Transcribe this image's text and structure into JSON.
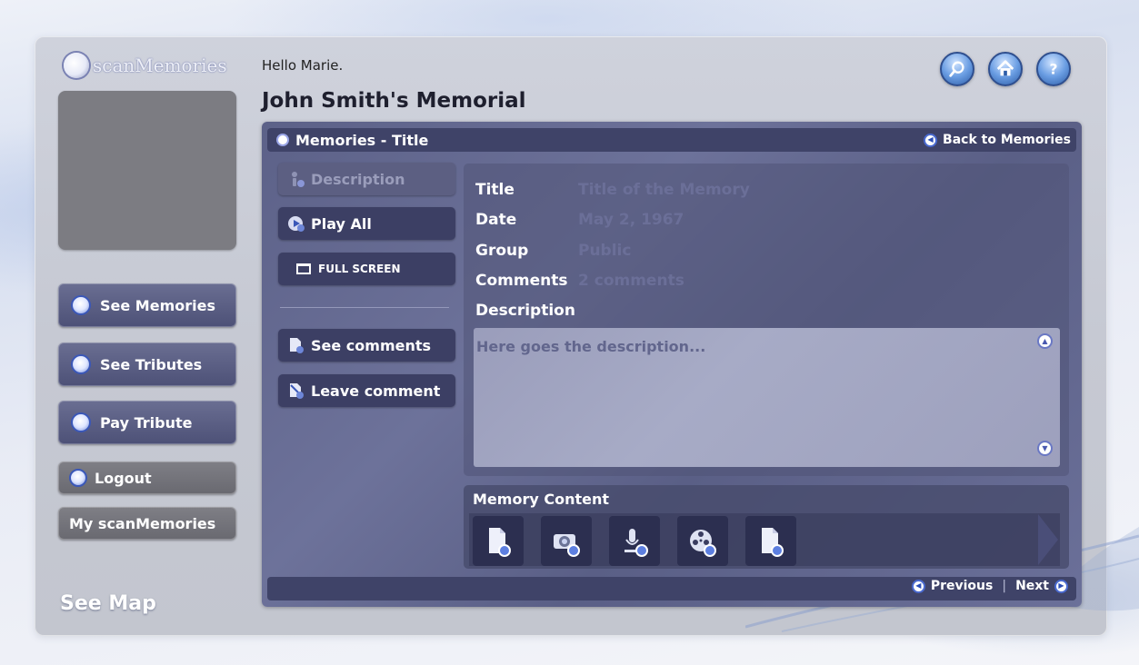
{
  "app": {
    "logo_text": "scanMemories"
  },
  "header": {
    "greeting": "Hello Marie.",
    "memorial_title": "John Smith's Memorial"
  },
  "top_icons": [
    "search-icon",
    "home-icon",
    "help-icon"
  ],
  "sidebar": {
    "see_memories": "See Memories",
    "see_tributes": "See Tributes",
    "pay_tribute": "Pay Tribute",
    "logout": "Logout",
    "my_scanmemories": "My scanMemories",
    "see_map": "See Map"
  },
  "panel": {
    "title": "Memories - Title",
    "back_link": "Back to Memories"
  },
  "actions": {
    "description": "Description",
    "play_all": "Play All",
    "full_screen": "FULL SCREEN",
    "see_comments": "See comments",
    "leave_comment": "Leave comment"
  },
  "details": {
    "title_label": "Title",
    "title_value": "Title of the Memory",
    "date_label": "Date",
    "date_value": "May 2, 1967",
    "group_label": "Group",
    "group_value": "Public",
    "comments_label": "Comments",
    "comments_value": "2 comments",
    "description_label": "Description",
    "description_text": "Here goes the description..."
  },
  "memory_content": {
    "title": "Memory Content",
    "items": [
      "document-icon",
      "camera-icon",
      "microphone-icon",
      "film-reel-icon",
      "document-icon"
    ]
  },
  "footer": {
    "previous": "Previous",
    "divider": "|",
    "next": "Next"
  },
  "colors": {
    "panel": "#5c6188",
    "header_bar": "#3f4368",
    "button": "#3c3f64",
    "field_value": "#6b6f98",
    "accent_blue": "#3a57b8"
  }
}
